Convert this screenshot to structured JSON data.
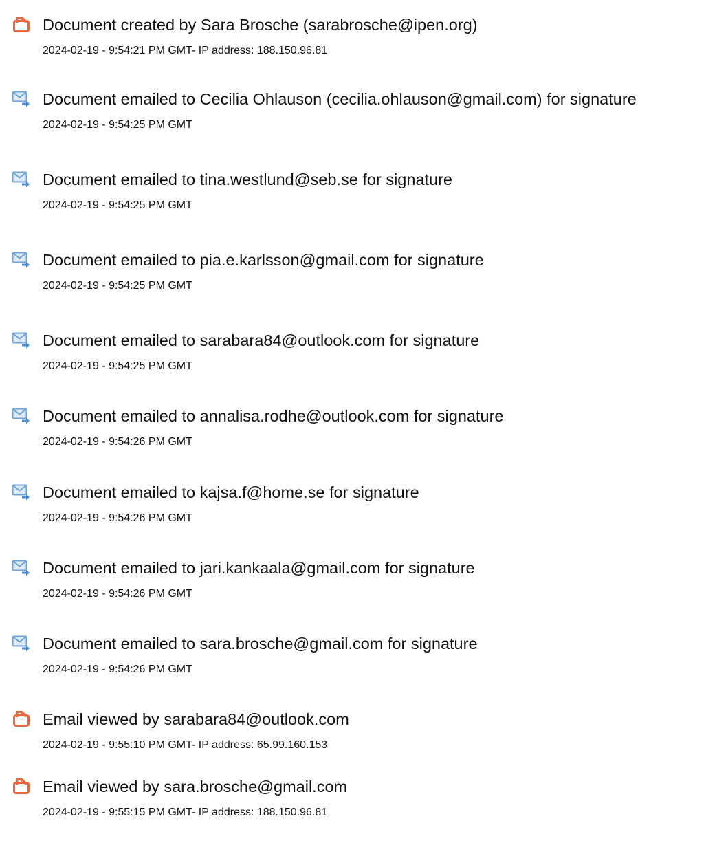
{
  "events": [
    {
      "icon": "document-icon",
      "title": "Document created by Sara Brosche (sarabrosche@ipen.org)",
      "meta": "2024-02-19 - 9:54:21 PM GMT- IP address: 188.150.96.81"
    },
    {
      "icon": "email-sent-icon",
      "title": "Document emailed to Cecilia Ohlauson (cecilia.ohlauson@gmail.com) for signature",
      "meta": "2024-02-19 - 9:54:25 PM GMT"
    },
    {
      "icon": "email-sent-icon",
      "title": "Document emailed to tina.westlund@seb.se for signature",
      "meta": "2024-02-19 - 9:54:25 PM GMT"
    },
    {
      "icon": "email-sent-icon",
      "title": "Document emailed to pia.e.karlsson@gmail.com for signature",
      "meta": "2024-02-19 - 9:54:25 PM GMT"
    },
    {
      "icon": "email-sent-icon",
      "title": "Document emailed to sarabara84@outlook.com for signature",
      "meta": "2024-02-19 - 9:54:25 PM GMT"
    },
    {
      "icon": "email-sent-icon",
      "title": "Document emailed to annalisa.rodhe@outlook.com for signature",
      "meta": "2024-02-19 - 9:54:26 PM GMT"
    },
    {
      "icon": "email-sent-icon",
      "title": "Document emailed to kajsa.f@home.se for signature",
      "meta": "2024-02-19 - 9:54:26 PM GMT"
    },
    {
      "icon": "email-sent-icon",
      "title": "Document emailed to jari.kankaala@gmail.com for signature",
      "meta": "2024-02-19 - 9:54:26 PM GMT"
    },
    {
      "icon": "email-sent-icon",
      "title": "Document emailed to sara.brosche@gmail.com for signature",
      "meta": "2024-02-19 - 9:54:26 PM GMT"
    },
    {
      "icon": "document-icon",
      "title": "Email viewed by sarabara84@outlook.com",
      "meta": "2024-02-19 - 9:55:10 PM GMT- IP address: 65.99.160.153"
    },
    {
      "icon": "document-icon",
      "title": "Email viewed by sara.brosche@gmail.com",
      "meta": "2024-02-19 - 9:55:15 PM GMT- IP address: 188.150.96.81"
    }
  ],
  "colors": {
    "document_icon": "#e8673c",
    "email_icon": "#6fa3d9",
    "text": "#111111"
  }
}
